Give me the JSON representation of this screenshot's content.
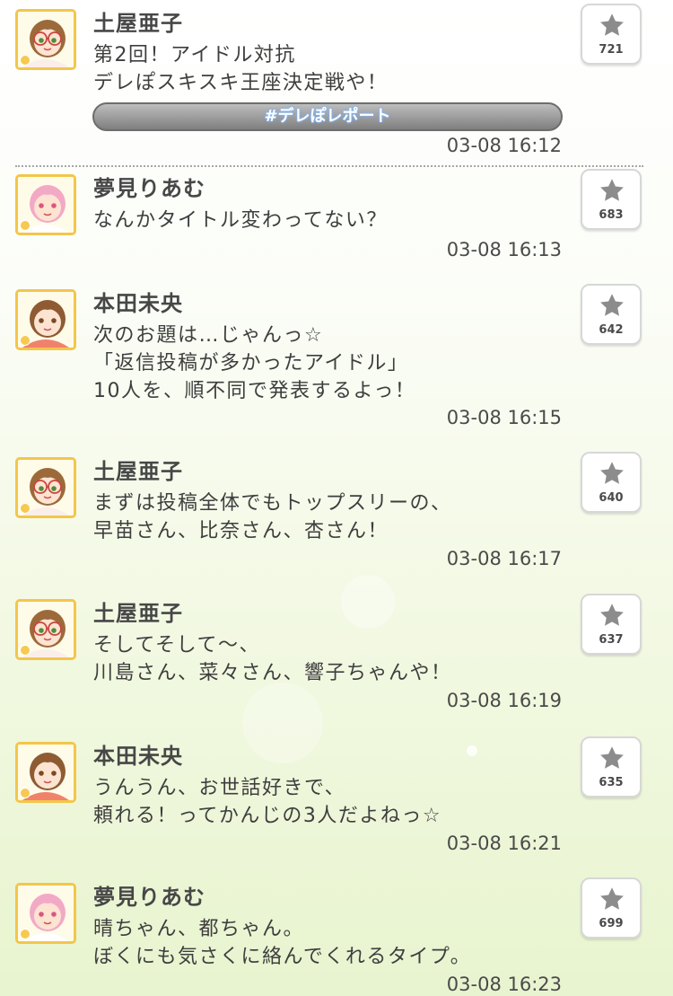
{
  "feed": {
    "posts": [
      {
        "author": "土屋亜子",
        "text": "第2回！アイドル対抗\nデレぽスキスキ王座決定戦や！",
        "hashtag": "#デレぽレポート",
        "time": "03-08 16:12",
        "likes": "721",
        "avatar": "ako"
      },
      {
        "author": "夢見りあむ",
        "text": "なんかタイトル変わってない？",
        "time": "03-08 16:13",
        "likes": "683",
        "avatar": "riamu"
      },
      {
        "author": "本田未央",
        "text": "次のお題は…じゃんっ☆\n「返信投稿が多かったアイドル」\n10人を、順不同で発表するよっ！",
        "time": "03-08 16:15",
        "likes": "642",
        "avatar": "mio"
      },
      {
        "author": "土屋亜子",
        "text": "まずは投稿全体でもトップスリーの、\n早苗さん、比奈さん、杏さん！",
        "time": "03-08 16:17",
        "likes": "640",
        "avatar": "ako"
      },
      {
        "author": "土屋亜子",
        "text": "そしてそして〜、\n川島さん、菜々さん、響子ちゃんや！",
        "time": "03-08 16:19",
        "likes": "637",
        "avatar": "ako"
      },
      {
        "author": "本田未央",
        "text": "うんうん、お世話好きで、\n頼れる！ってかんじの3人だよねっ☆",
        "time": "03-08 16:21",
        "likes": "635",
        "avatar": "mio"
      },
      {
        "author": "夢見りあむ",
        "text": "晴ちゃん、都ちゃん。\nぼくにも気さくに絡んでくれるタイプ。",
        "time": "03-08 16:23",
        "likes": "699",
        "avatar": "riamu"
      }
    ]
  },
  "icons": {
    "like": "star-icon"
  },
  "colors": {
    "avatar_frame": "#f3c64a",
    "hair": {
      "ako": "#9c6a3a",
      "riamu": "#f2a9c6",
      "mio": "#8e5b33"
    },
    "outfit": {
      "ako": "#fbeee9",
      "riamu": "#ffffff",
      "mio": "#f0826c"
    }
  }
}
